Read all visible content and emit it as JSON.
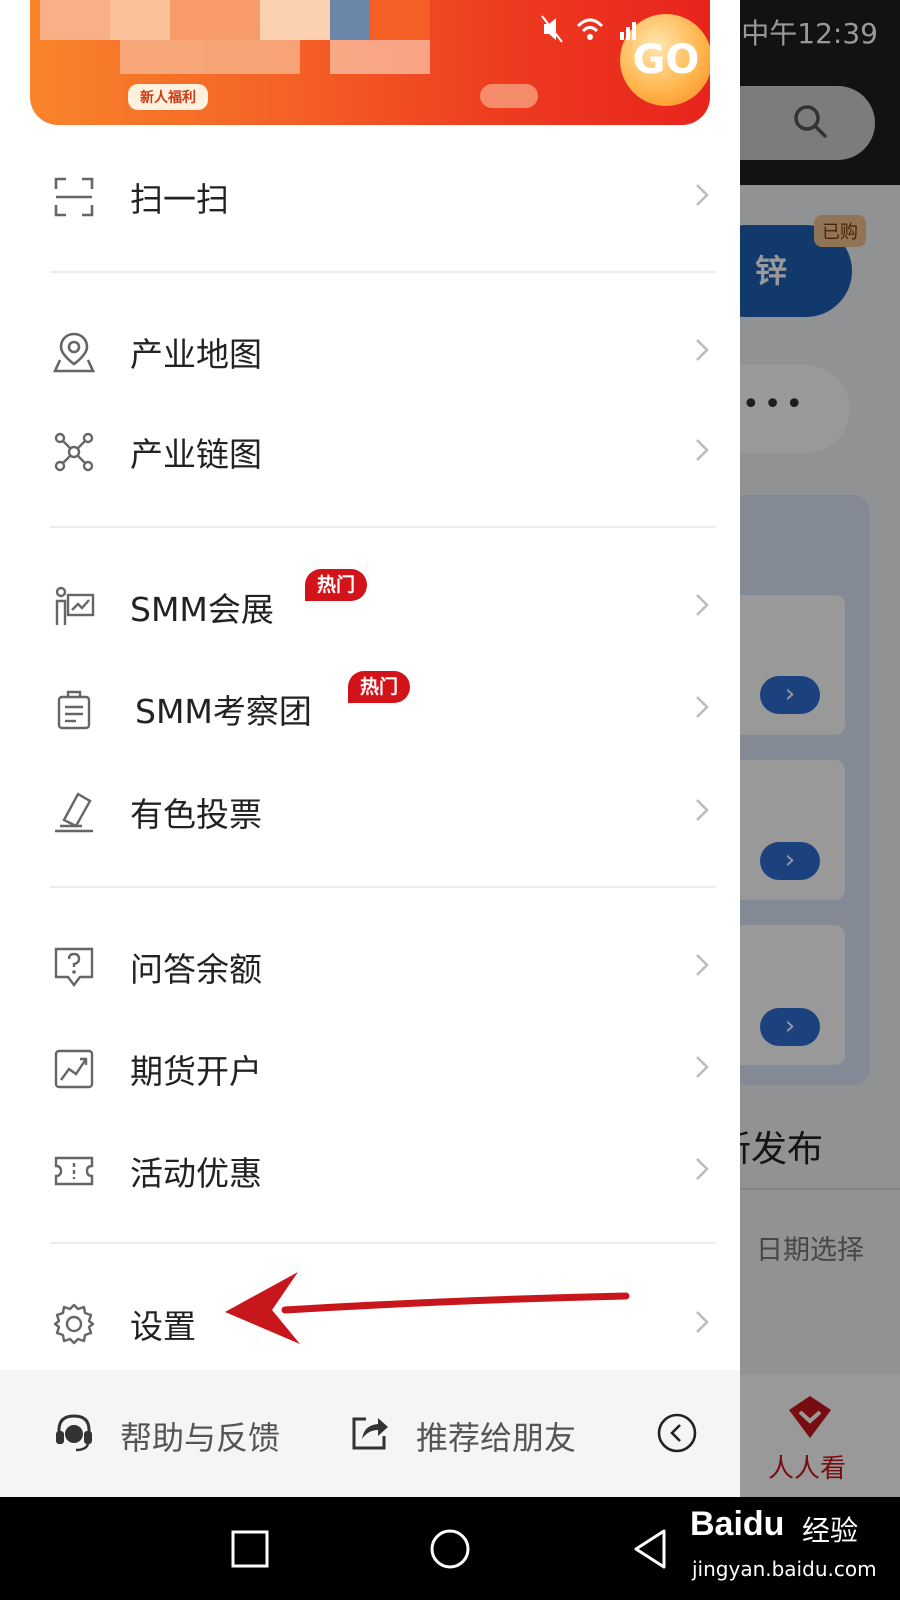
{
  "status_bar": {
    "time": "中午12:39"
  },
  "background_app": {
    "zinc_chip": "锌",
    "bought_tag": "已购",
    "more_dots": "•••",
    "new_release_partial": "新发布",
    "date_select": "日期选择",
    "tab_renrenkan": "人人看",
    "arrow_glyph": "›"
  },
  "drawer": {
    "banner": {
      "badge": "新人福利",
      "go_label": "GO"
    },
    "menu": {
      "scan": {
        "label": "扫一扫",
        "icon": "scan-icon"
      },
      "industry_map": {
        "label": "产业地图",
        "icon": "map-pin-icon"
      },
      "industry_chain": {
        "label": "产业链图",
        "icon": "network-icon"
      },
      "smm_expo": {
        "label": "SMM会展",
        "icon": "expo-icon",
        "badge": "热门"
      },
      "smm_tour": {
        "label": "SMM考察团",
        "icon": "clipboard-icon",
        "badge": "热门"
      },
      "nonferrous_vote": {
        "label": "有色投票",
        "icon": "vote-icon"
      },
      "qa_balance": {
        "label": "问答余额",
        "icon": "question-icon"
      },
      "futures_account": {
        "label": "期货开户",
        "icon": "trend-chart-icon"
      },
      "promotions": {
        "label": "活动优惠",
        "icon": "ticket-icon"
      },
      "settings": {
        "label": "设置",
        "icon": "gear-icon"
      }
    },
    "footer": {
      "help": "帮助与反馈",
      "share": "推荐给朋友"
    }
  },
  "watermark": {
    "brand": "Baidu",
    "product": "经验",
    "url": "jingyan.baidu.com"
  },
  "colors": {
    "accent_red": "#d2131a",
    "annotation_arrow": "#c8161d",
    "chip_blue": "#1f5fb5"
  }
}
